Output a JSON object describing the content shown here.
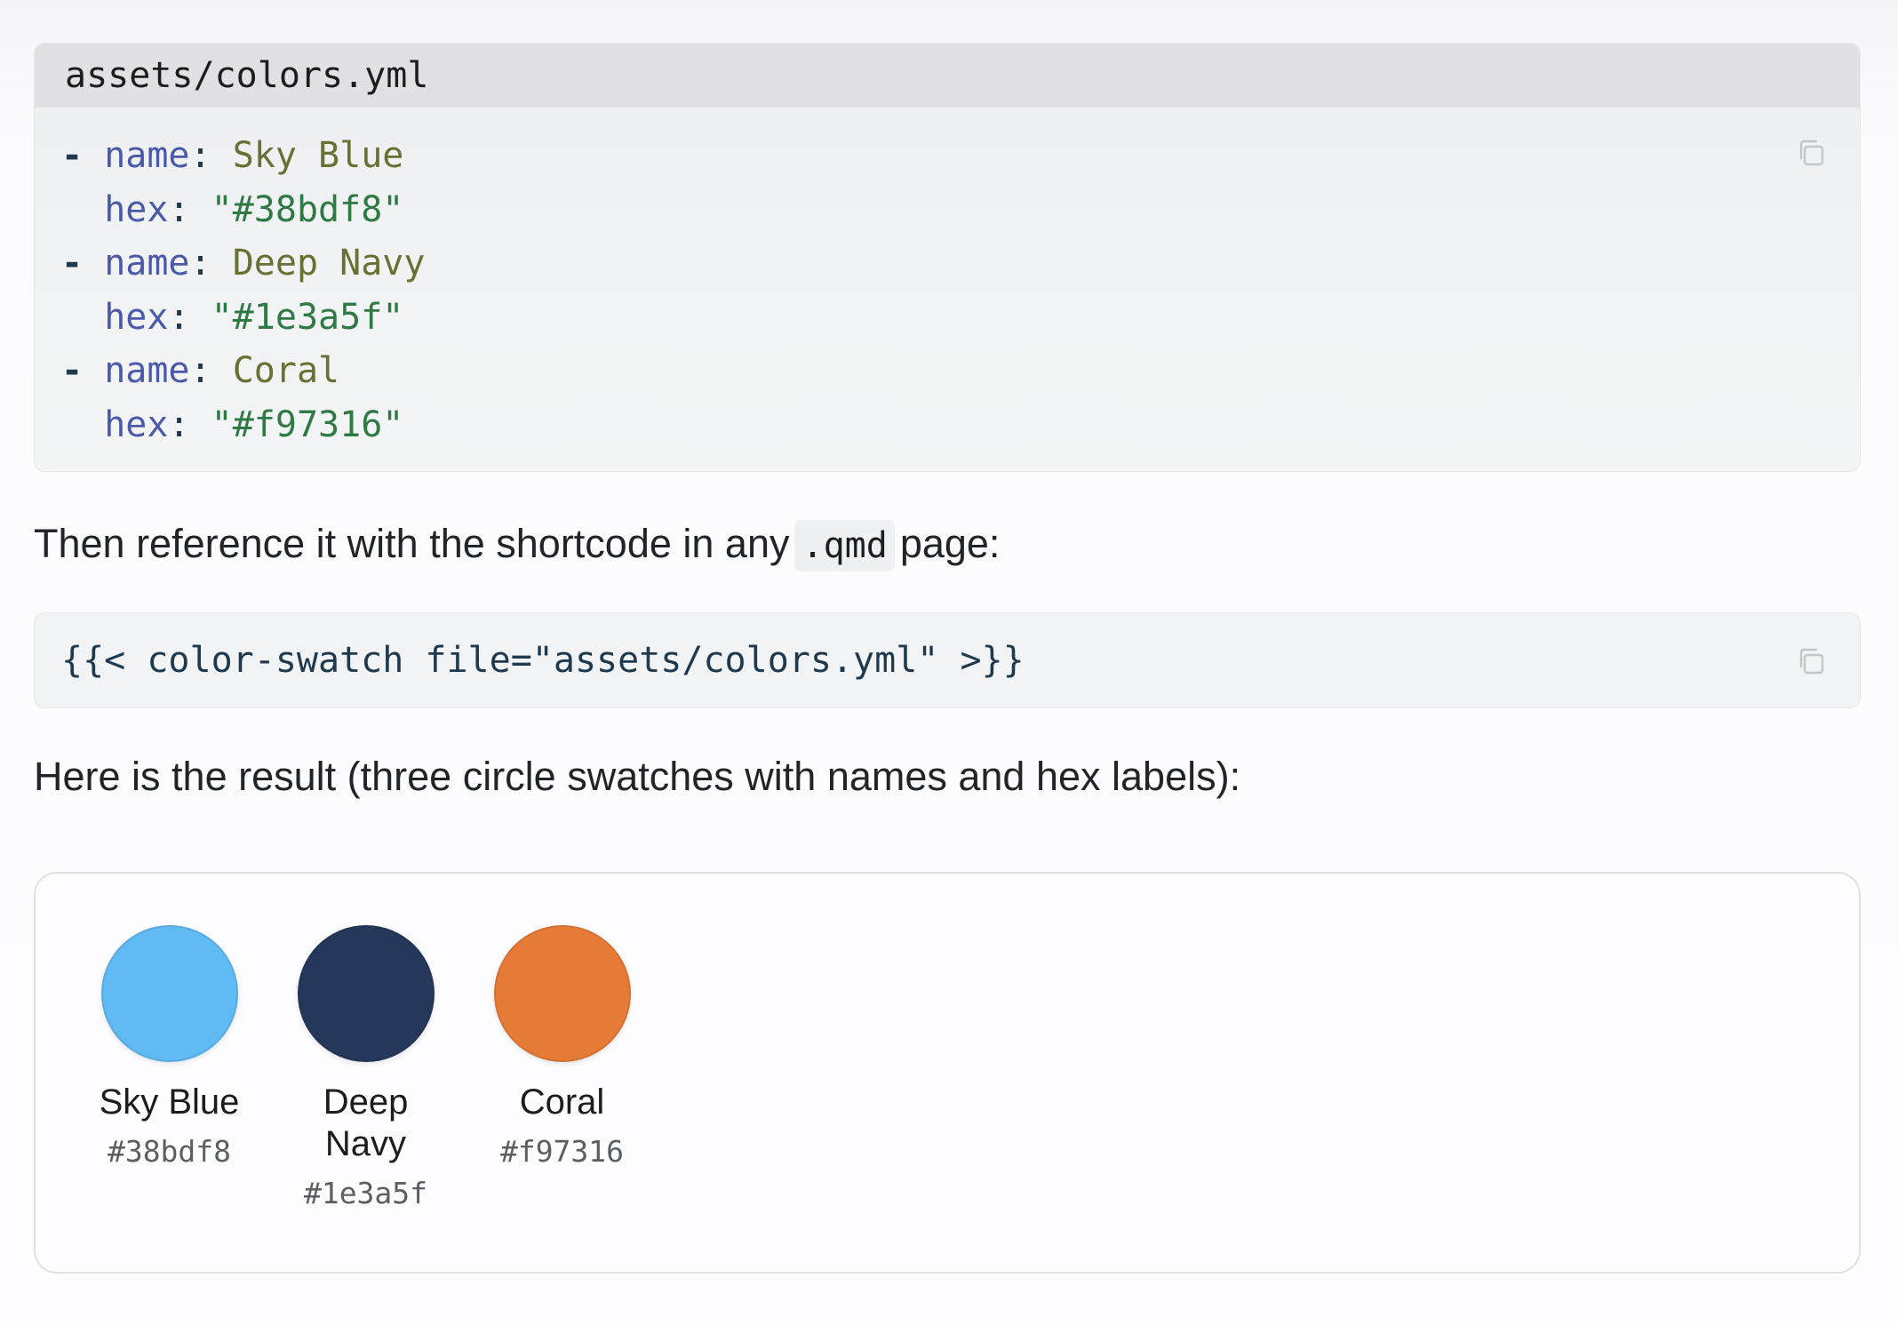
{
  "code_block": {
    "filename": "assets/colors.yml",
    "lines": [
      {
        "dash": "-",
        "key": "name",
        "colon": ":",
        "value": "Sky Blue",
        "value_type": "plain"
      },
      {
        "dash": " ",
        "key": "hex",
        "colon": ":",
        "value": "\"#38bdf8\"",
        "value_type": "string"
      },
      {
        "dash": "-",
        "key": "name",
        "colon": ":",
        "value": "Deep Navy",
        "value_type": "plain"
      },
      {
        "dash": " ",
        "key": "hex",
        "colon": ":",
        "value": "\"#1e3a5f\"",
        "value_type": "string"
      },
      {
        "dash": "-",
        "key": "name",
        "colon": ":",
        "value": "Coral",
        "value_type": "plain"
      },
      {
        "dash": " ",
        "key": "hex",
        "colon": ":",
        "value": "\"#f97316\"",
        "value_type": "string"
      }
    ],
    "copy_icon": "copy-icon"
  },
  "paragraph_1": {
    "before": "Then reference it with the shortcode in any",
    "code": ".qmd",
    "after": "page:"
  },
  "shortcode_block": {
    "text": "{{< color-swatch file=\"assets/colors.yml\" >}}",
    "copy_icon": "copy-icon"
  },
  "paragraph_2": {
    "text": "Here is the result (three circle swatches with names and hex labels):"
  },
  "swatches": [
    {
      "name": "Sky Blue",
      "hex": "#38bdf8",
      "fill": "#60baf3"
    },
    {
      "name": "Deep Navy",
      "hex": "#1e3a5f",
      "fill": "#25385b"
    },
    {
      "name": "Coral",
      "hex": "#f97316",
      "fill": "#e67b37"
    }
  ],
  "colors": {
    "code_background": "#f1f3f5",
    "filename_bar": "#e1e1e5",
    "yaml_key": "#4a5aa8",
    "yaml_value": "#687033",
    "yaml_string": "#2f7a44"
  }
}
